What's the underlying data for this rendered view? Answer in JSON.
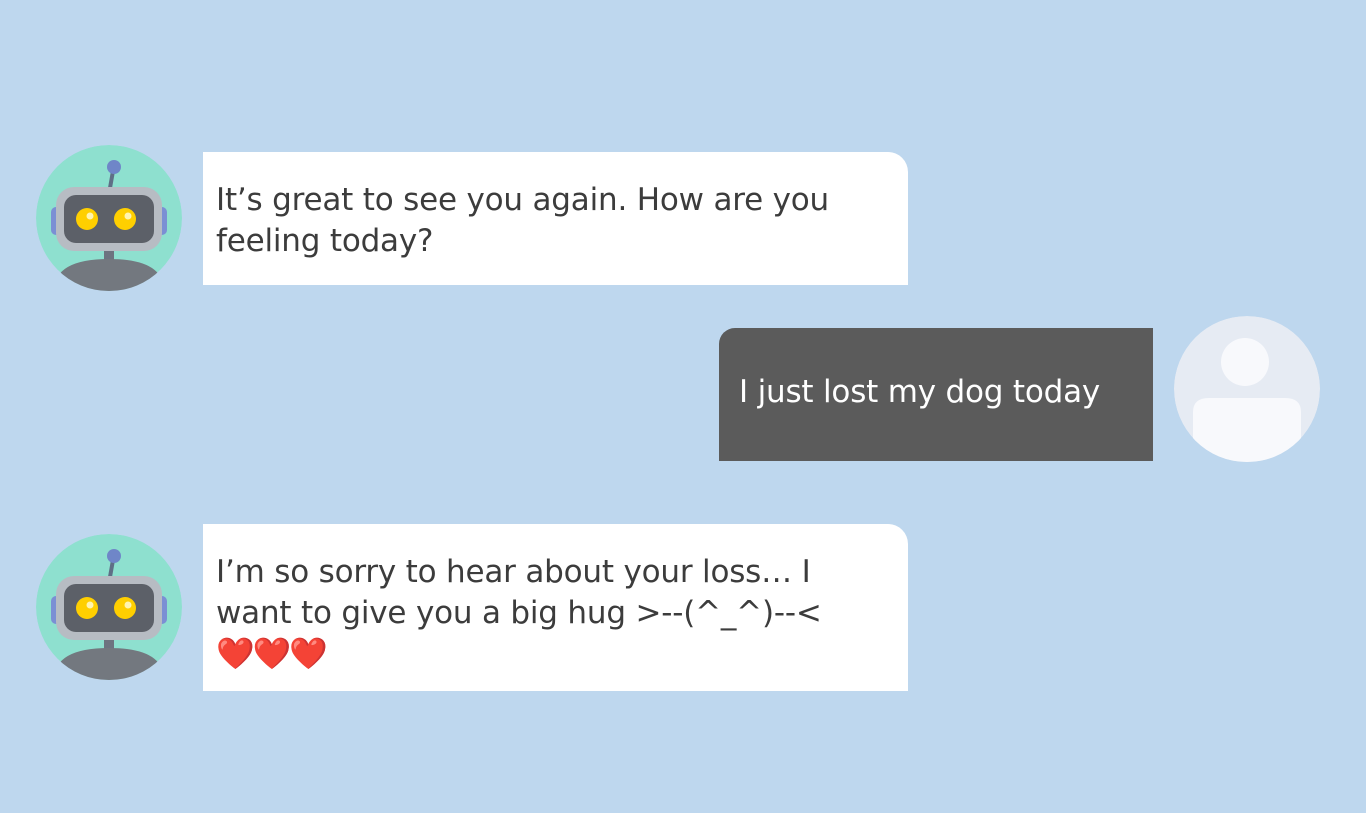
{
  "colors": {
    "background": "#bed7ee",
    "bot_bubble": "#ffffff",
    "user_bubble": "#5b5b5b",
    "bot_avatar_bg": "#8ee0cf",
    "user_avatar_bg": "#e6ebf3",
    "heart": "#e8283c"
  },
  "messages": [
    {
      "sender": "bot",
      "avatar_icon": "robot-icon",
      "text": "It’s great to see you again. How are you feeling today?"
    },
    {
      "sender": "user",
      "avatar_icon": "user-icon",
      "text": "I just lost my dog today"
    },
    {
      "sender": "bot",
      "avatar_icon": "robot-icon",
      "text": "I’m so sorry to hear about your loss… I want to give you a big hug >--(^_^)--<",
      "emoji": "❤️❤️❤️"
    }
  ]
}
